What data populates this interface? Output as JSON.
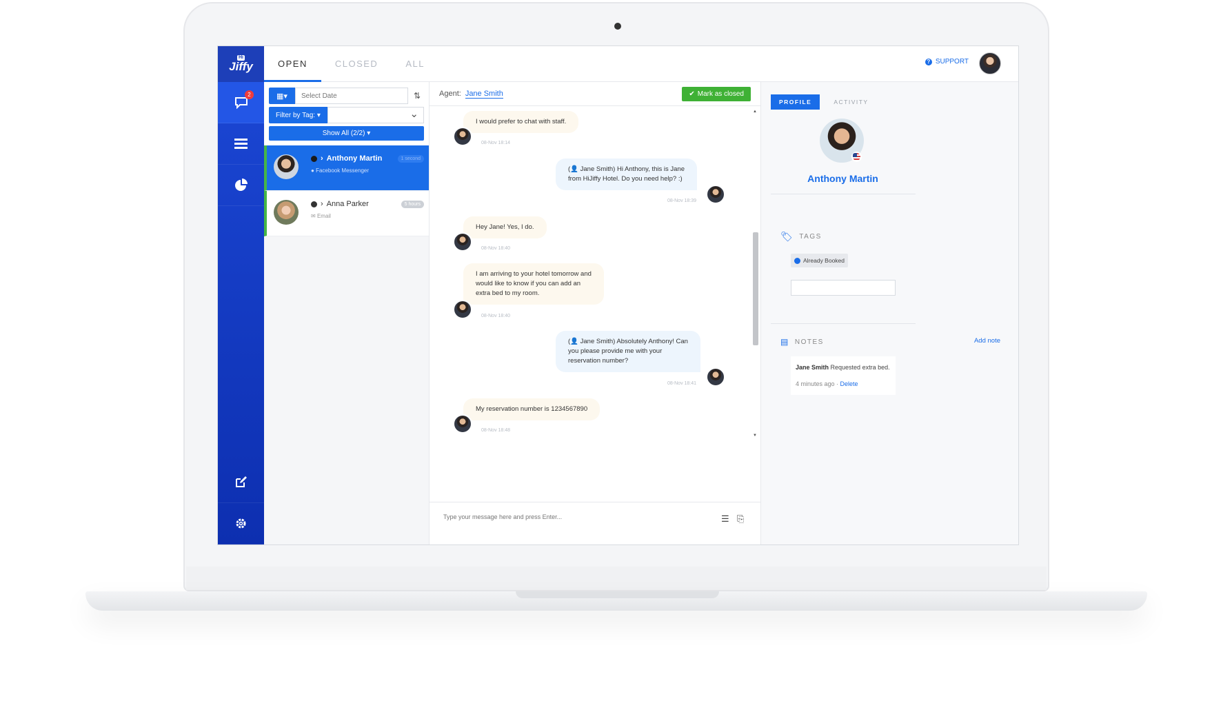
{
  "app": {
    "logo_hi": "Hi",
    "logo_name": "Jiffy",
    "unread_count": "2"
  },
  "tabs": [
    "OPEN",
    "CLOSED",
    "ALL"
  ],
  "header": {
    "support_label": "SUPPORT"
  },
  "filters": {
    "date_placeholder": "Select Date",
    "tag_filter_label": "Filter by Tag:",
    "show_all_label": "Show All (2/2)"
  },
  "conversations": [
    {
      "name": "Anthony Martin",
      "channel": "Facebook Messenger",
      "time": "1 second",
      "active": true
    },
    {
      "name": "Anna Parker",
      "channel": "Email",
      "time": "5 hours",
      "active": false
    }
  ],
  "chat": {
    "agent_label": "Agent:",
    "agent_name": "Jane Smith",
    "mark_closed_label": "Mark as closed",
    "composer_placeholder": "Type your message here and press Enter...",
    "messages": [
      {
        "dir": "in",
        "lines": [
          "I would prefer to chat with staff."
        ],
        "time": "08-Nov 18:14"
      },
      {
        "dir": "out",
        "lines": [
          "(👤 Jane Smith) Hi Anthony, this is Jane",
          "from HiJiffy Hotel. Do you need help? :)"
        ],
        "time": "08-Nov 18:39"
      },
      {
        "dir": "in",
        "lines": [
          "Hey Jane! Yes, I do."
        ],
        "time": "08-Nov 18:40"
      },
      {
        "dir": "in",
        "lines": [
          "I am arriving to your hotel tomorrow and",
          "would like to know if you can add an",
          "extra bed to my room."
        ],
        "time": "08-Nov 18:40"
      },
      {
        "dir": "out",
        "lines": [
          "(👤 Jane Smith) Absolutely Anthony! Can",
          "you please provide me with your",
          "reservation number?"
        ],
        "time": "08-Nov 18:41"
      },
      {
        "dir": "in",
        "lines": [
          "My reservation number is 1234567890"
        ],
        "time": "08-Nov 18:48"
      }
    ]
  },
  "profile": {
    "tab_profile": "PROFILE",
    "tab_activity": "ACTIVITY",
    "name": "Anthony Martin",
    "tags_label": "TAGS",
    "tags": [
      "Already Booked"
    ],
    "notes_label": "NOTES",
    "add_note_label": "Add note",
    "note": {
      "author": "Jane Smith",
      "text": "Requested extra bed.",
      "time": "4 minutes ago",
      "separator": " · ",
      "delete_label": "Delete"
    }
  },
  "colors": {
    "brand_blue": "#1a6de8",
    "rail_blue": "#1c48d6",
    "success_green": "#3fb135",
    "badge_red": "#ef3b3b"
  }
}
